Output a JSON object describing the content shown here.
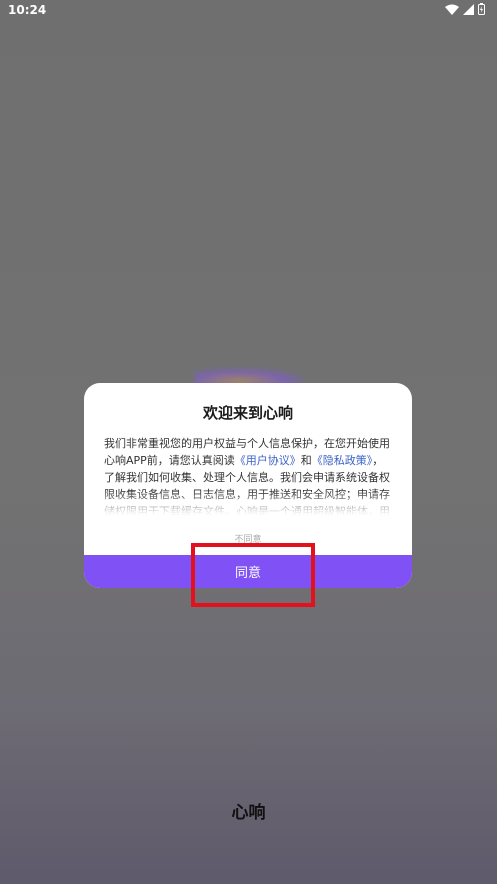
{
  "status_bar": {
    "time": "10:24"
  },
  "dialog": {
    "title": "欢迎来到心响",
    "body_part1": "我们非常重视您的用户权益与个人信息保护，在您开始使用心响APP前，请您认真阅读",
    "user_agreement_link": "《用户协议》",
    "and_text": "和",
    "privacy_policy_link": "《隐私政策》",
    "body_part2": "，了解我们如何收集、处理个人信息。我们会申请系统设备权限收集设备信息、日志信息，用于推送和安全风控；申请存储权限用于下载缓存文件。心响是一个通用超级智能体，用",
    "disagree_label": "不同意",
    "agree_label": "同意"
  },
  "app": {
    "name": "心响"
  },
  "colors": {
    "accent": "#8052f5",
    "link": "#3a61c7",
    "highlight": "#e3101d"
  },
  "icons": [
    "wifi-icon",
    "signal-icon",
    "battery-icon"
  ]
}
